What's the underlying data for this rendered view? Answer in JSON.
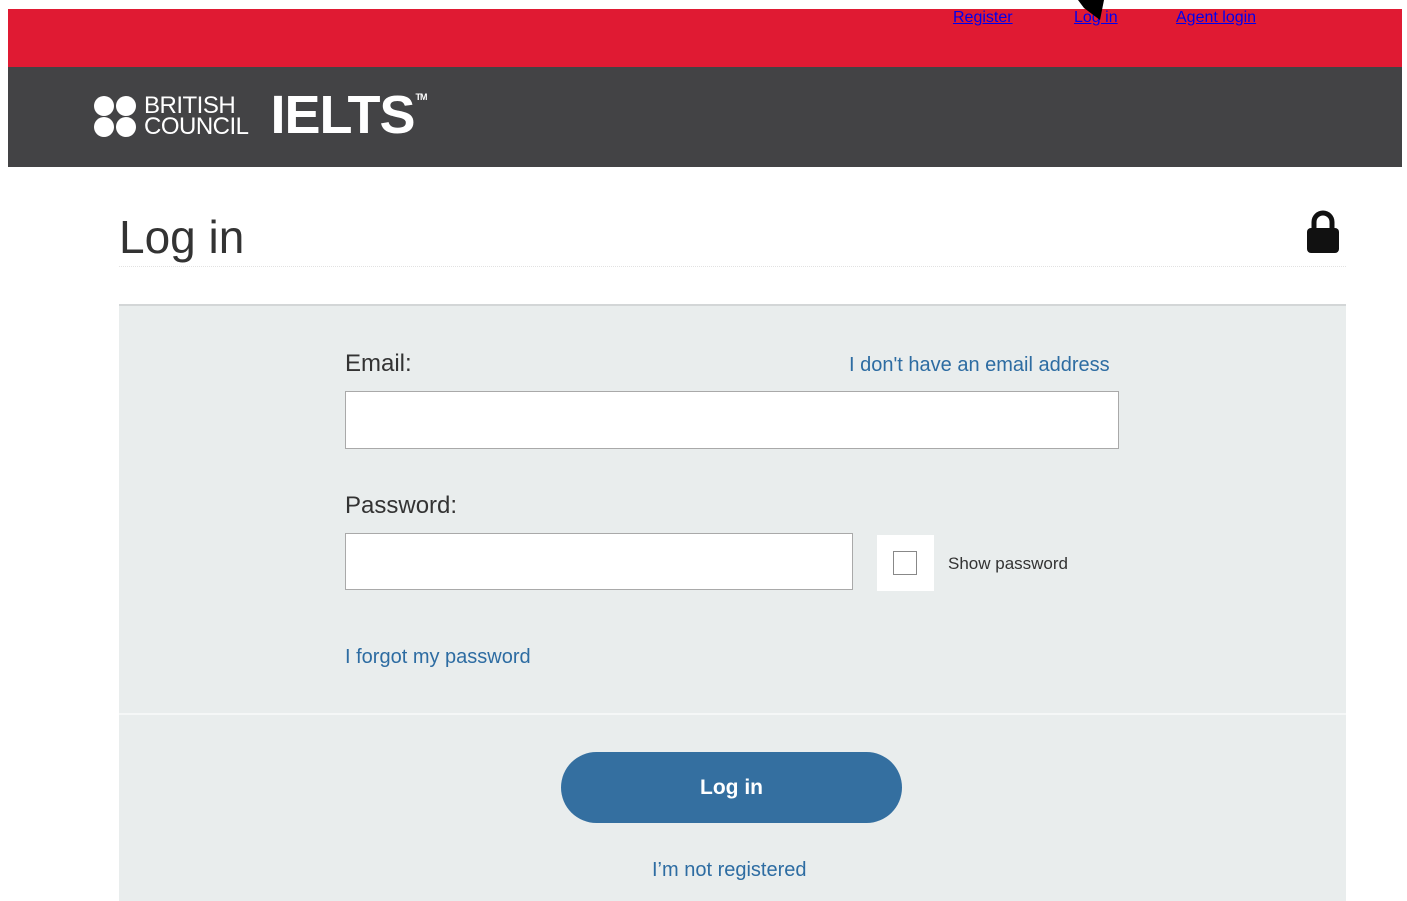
{
  "topnav": {
    "register": "Register",
    "login": "Log in",
    "agent_login": "Agent login"
  },
  "header": {
    "brand_line1": "BRITISH",
    "brand_line2": "COUNCIL",
    "product": "IELTS",
    "trademark": "TM"
  },
  "page": {
    "title": "Log in",
    "lock_icon": "lock-icon"
  },
  "form": {
    "email_label": "Email:",
    "no_email_link": "I don't have an email address",
    "email_value": "",
    "password_label": "Password:",
    "password_value": "",
    "show_password_label": "Show password",
    "show_password_checked": false,
    "forgot_link": "I forgot my password",
    "submit_label": "Log in",
    "not_registered_link": "I’m not registered"
  },
  "colors": {
    "topbar": "#e01a33",
    "topnav_item": "#cc1730",
    "header": "#434345",
    "panel": "#e9eded",
    "link": "#2d6ca2",
    "button": "#346fa0"
  }
}
